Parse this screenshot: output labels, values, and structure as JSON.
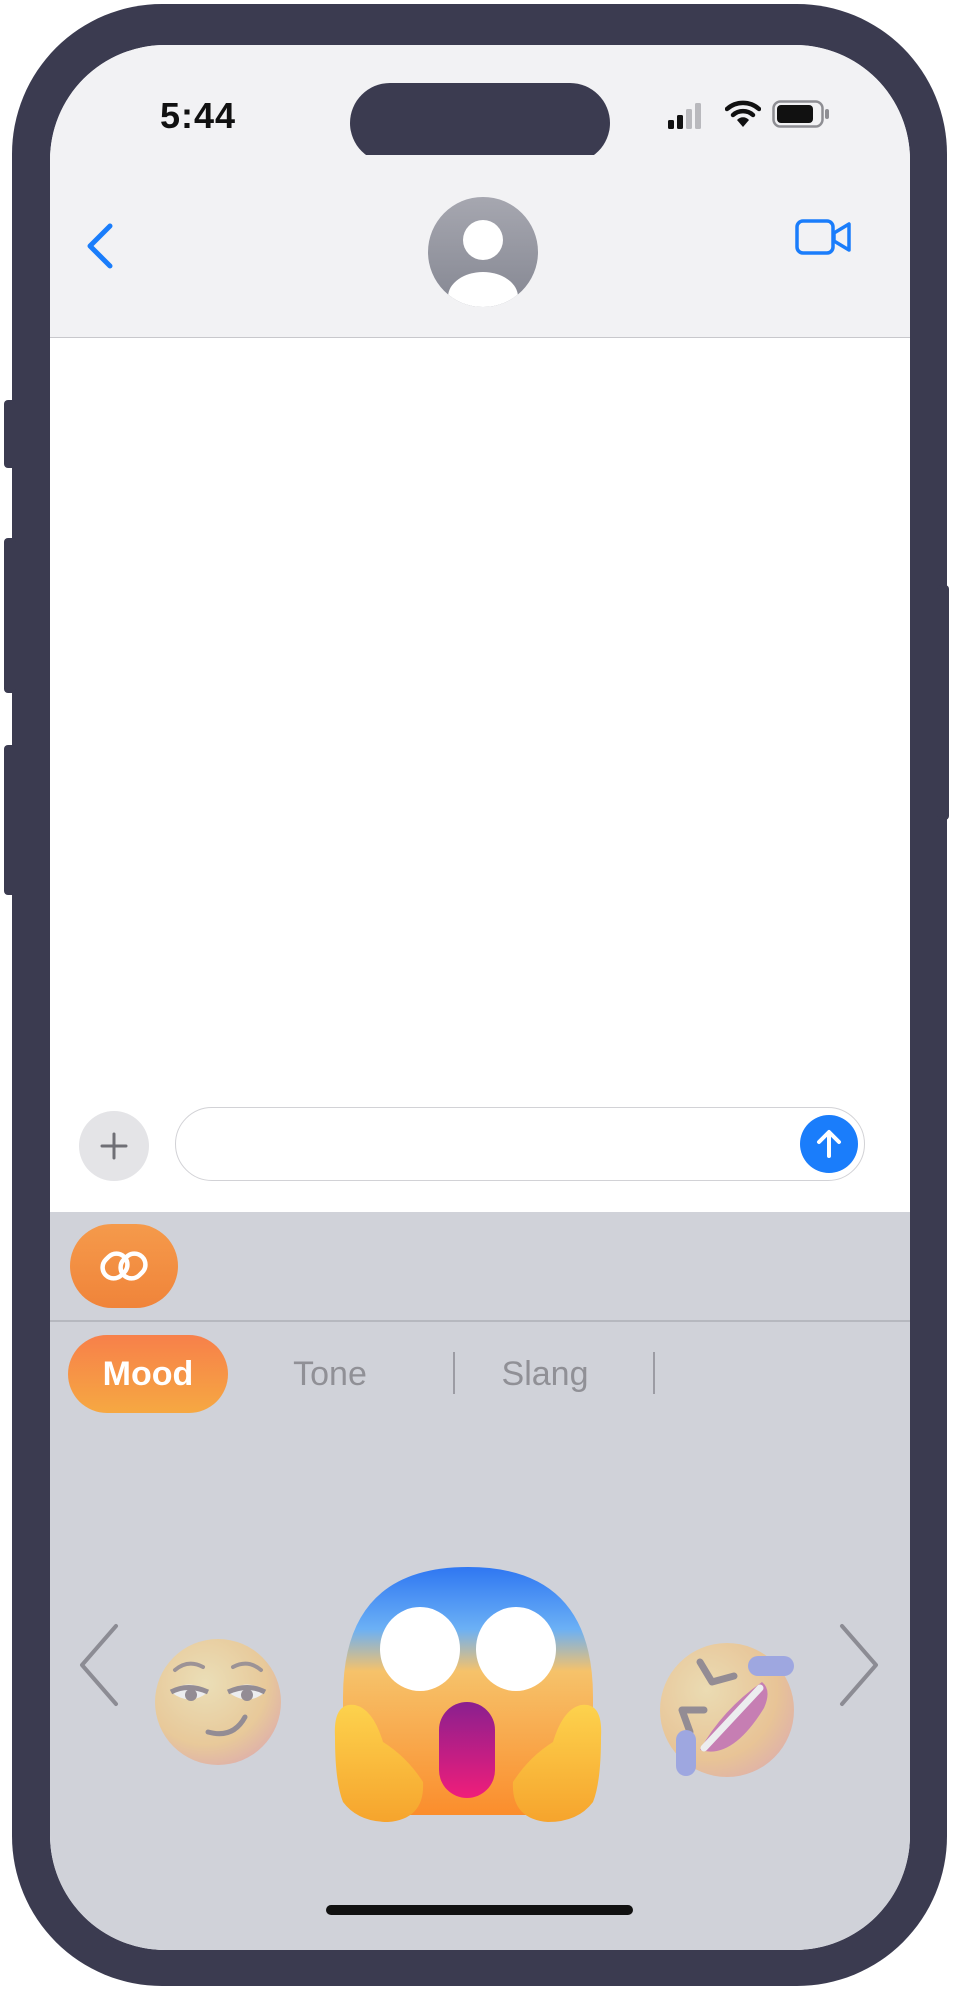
{
  "status_bar": {
    "time": "5:44",
    "icons": [
      "cellular-signal-icon",
      "wifi-icon",
      "battery-icon"
    ]
  },
  "nav_bar": {
    "back_icon": "chevron-left-icon",
    "contact_icon": "person-avatar-icon",
    "video_icon": "video-camera-icon"
  },
  "composer": {
    "add_icon": "plus-icon",
    "message_value": "",
    "message_placeholder": "",
    "send_icon": "arrow-up-icon"
  },
  "app_panel": {
    "app_icon": "interlocking-rings-icon",
    "tabs": [
      {
        "label": "Mood",
        "active": true
      },
      {
        "label": "Tone",
        "active": false
      },
      {
        "label": "Slang",
        "active": false
      }
    ],
    "carousel": {
      "prev_icon": "chevron-left-icon",
      "next_icon": "chevron-right-icon",
      "items": [
        {
          "name": "relieved-face-emoji",
          "selected": false
        },
        {
          "name": "face-screaming-in-fear-emoji",
          "selected": true
        },
        {
          "name": "rolling-on-floor-laughing-emoji",
          "selected": false
        }
      ]
    }
  },
  "colors": {
    "accent": "#1a7dfb",
    "mood_gradient_start": "#f7804a",
    "mood_gradient_end": "#f6a842",
    "panel_background": "#d0d2d9",
    "phone_frame": "#3b3b50"
  }
}
